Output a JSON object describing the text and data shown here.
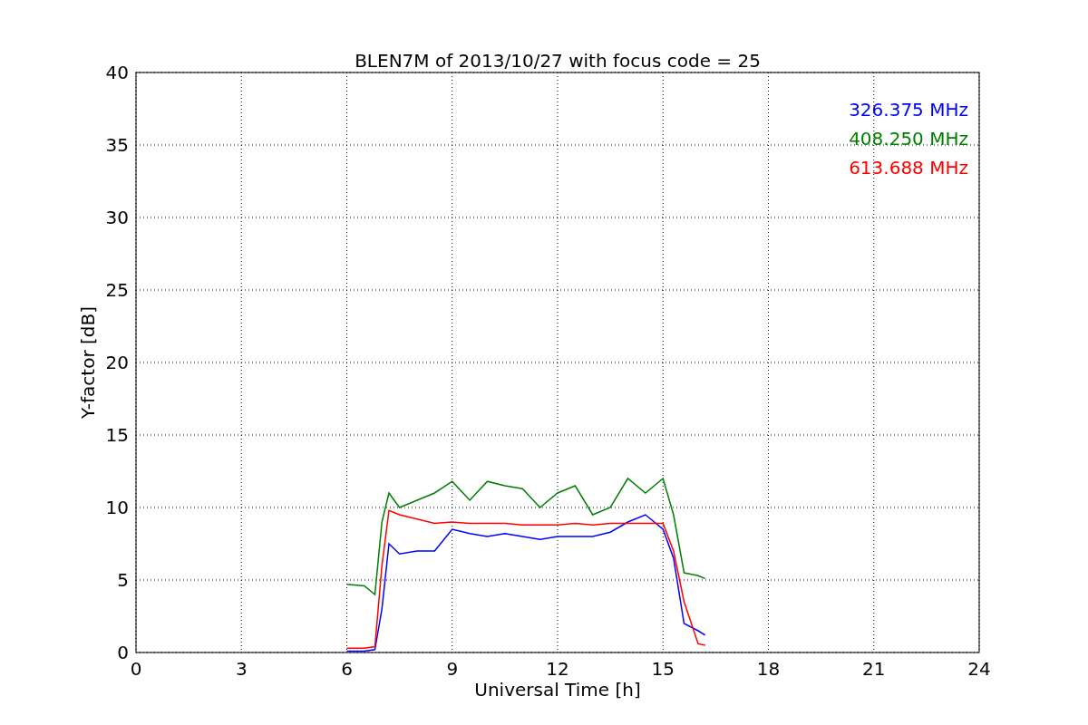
{
  "figure": {
    "chart_data": {
      "type": "line",
      "title": "BLEN7M of 2013/10/27 with focus code = 25",
      "xlabel": "Universal Time [h]",
      "ylabel": "Y-factor [dB]",
      "x": [
        6,
        6.5,
        6.8,
        7,
        7.2,
        7.5,
        8,
        8.5,
        9,
        9.5,
        10,
        10.5,
        11,
        11.5,
        12,
        12.5,
        13,
        13.5,
        14,
        14.5,
        15,
        15.3,
        15.6,
        16,
        16.2
      ],
      "series": [
        {
          "name": "326.375 MHz",
          "color": "#0000ff",
          "values": [
            0.1,
            0.1,
            0.2,
            3,
            7.5,
            6.8,
            7,
            7,
            8.5,
            8.2,
            8,
            8.2,
            8,
            7.8,
            8,
            8,
            8,
            8.3,
            9,
            9.5,
            8.5,
            6.5,
            2,
            1.5,
            1.2
          ]
        },
        {
          "name": "408.250 MHz",
          "color": "#008000",
          "values": [
            4.7,
            4.6,
            4,
            9,
            11,
            10,
            10.5,
            11,
            11.8,
            10.5,
            11.8,
            11.5,
            11.3,
            10,
            11,
            11.5,
            9.5,
            10,
            12,
            11,
            12,
            9.5,
            5.5,
            5.3,
            5.1
          ]
        },
        {
          "name": "613.688 MHz",
          "color": "#ff0000",
          "values": [
            0.3,
            0.3,
            0.4,
            6,
            9.8,
            9.5,
            9.2,
            8.9,
            9,
            8.9,
            8.9,
            8.9,
            8.8,
            8.8,
            8.8,
            8.9,
            8.8,
            8.9,
            8.9,
            8.9,
            8.9,
            7,
            3.5,
            0.6,
            0.5
          ]
        }
      ],
      "xlim": [
        0,
        24
      ],
      "ylim": [
        0,
        40
      ],
      "xticks": [
        0,
        3,
        6,
        9,
        12,
        15,
        18,
        21,
        24
      ],
      "yticks": [
        0,
        5,
        10,
        15,
        20,
        25,
        30,
        35,
        40
      ],
      "grid": true
    }
  }
}
